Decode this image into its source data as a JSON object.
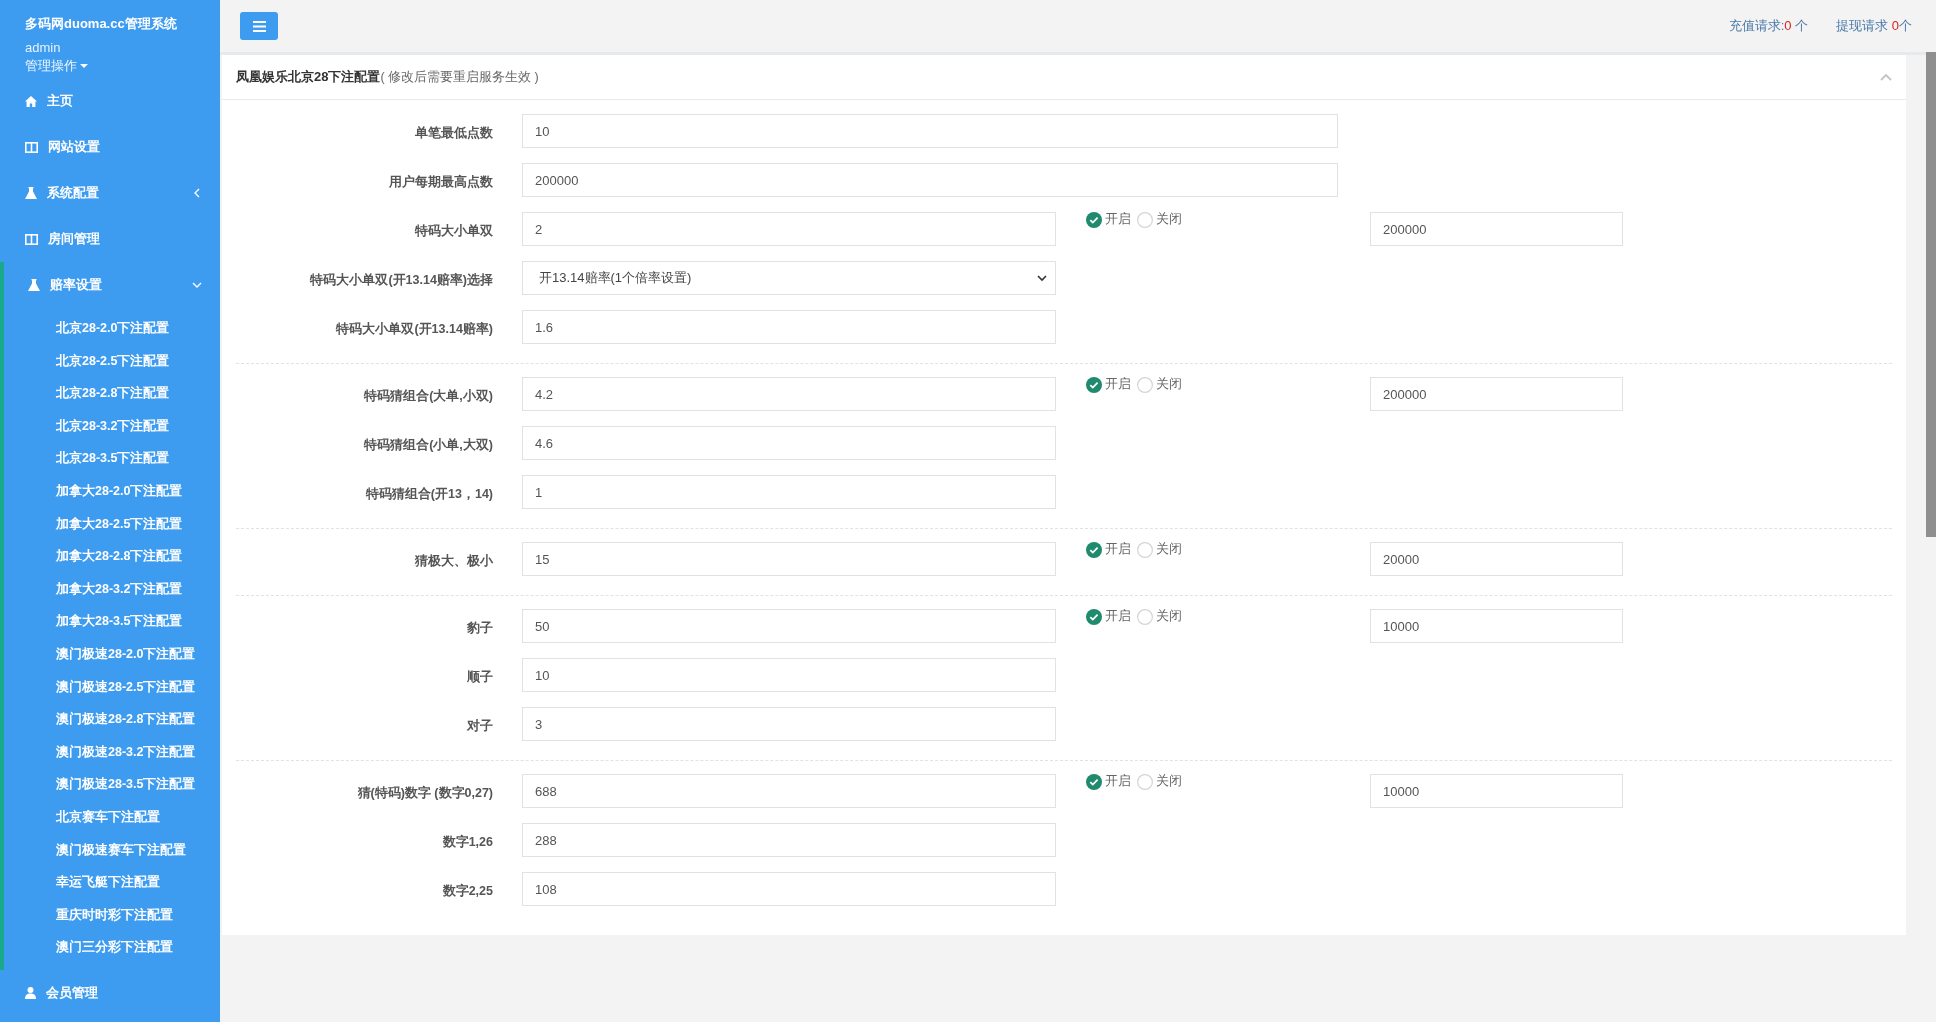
{
  "sidebar": {
    "brand": "多码网duoma.cc管理系统",
    "user": "admin",
    "user_menu": "管理操作",
    "items": [
      {
        "label": "主页",
        "kind": "home"
      },
      {
        "label": "网站设置",
        "kind": "page"
      },
      {
        "label": "系统配置",
        "kind": "group",
        "expanded": false
      },
      {
        "label": "房间管理",
        "kind": "page"
      },
      {
        "label": "赔率设置",
        "kind": "group",
        "expanded": true,
        "children": [
          {
            "label": "北京28-2.0下注配置"
          },
          {
            "label": "北京28-2.5下注配置"
          },
          {
            "label": "北京28-2.8下注配置"
          },
          {
            "label": "北京28-3.2下注配置"
          },
          {
            "label": "北京28-3.5下注配置"
          },
          {
            "label": "加拿大28-2.0下注配置"
          },
          {
            "label": "加拿大28-2.5下注配置"
          },
          {
            "label": "加拿大28-2.8下注配置"
          },
          {
            "label": "加拿大28-3.2下注配置"
          },
          {
            "label": "加拿大28-3.5下注配置"
          },
          {
            "label": "澳门极速28-2.0下注配置"
          },
          {
            "label": "澳门极速28-2.5下注配置"
          },
          {
            "label": "澳门极速28-2.8下注配置"
          },
          {
            "label": "澳门极速28-3.2下注配置"
          },
          {
            "label": "澳门极速28-3.5下注配置"
          },
          {
            "label": "北京赛车下注配置"
          },
          {
            "label": "澳门极速赛车下注配置"
          },
          {
            "label": "幸运飞艇下注配置"
          },
          {
            "label": "重庆时时彩下注配置"
          },
          {
            "label": "澳门三分彩下注配置"
          }
        ]
      },
      {
        "label": "会员管理",
        "kind": "members"
      }
    ]
  },
  "topbar": {
    "requests": [
      {
        "label": "充值请求:",
        "count": "0",
        "unit": " 个"
      },
      {
        "label": "提现请求 ",
        "count": "0",
        "unit": "个"
      }
    ]
  },
  "panel": {
    "title": "凤凰娱乐北京28下注配置",
    "note": "( 修改后需要重启服务生效 )",
    "sections": [
      {
        "rows": [
          {
            "kind": "wide",
            "label": "单笔最低点数",
            "value": "10"
          },
          {
            "kind": "wide",
            "label": "用户每期最高点数",
            "value": "200000"
          },
          {
            "kind": "input",
            "label": "特码大小单双",
            "value": "2",
            "toggle": {
              "on_label": "开启",
              "off_label": "关闭",
              "on": true
            },
            "limit": "200000"
          },
          {
            "kind": "select",
            "label": "特码大小单双(开13.14赔率)选择",
            "value": "开13.14赔率(1个倍率设置)"
          },
          {
            "kind": "input",
            "label": "特码大小单双(开13.14赔率)",
            "value": "1.6"
          }
        ]
      },
      {
        "rows": [
          {
            "kind": "input",
            "label": "特码猜组合(大单,小双)",
            "value": "4.2",
            "toggle": {
              "on_label": "开启",
              "off_label": "关闭",
              "on": true
            },
            "limit": "200000"
          },
          {
            "kind": "input",
            "label": "特码猜组合(小单,大双)",
            "value": "4.6"
          },
          {
            "kind": "input",
            "label": "特码猜组合(开13，14)",
            "value": "1"
          }
        ]
      },
      {
        "rows": [
          {
            "kind": "input",
            "label": "猜极大、极小",
            "value": "15",
            "toggle": {
              "on_label": "开启",
              "off_label": "关闭",
              "on": true
            },
            "limit": "20000"
          }
        ]
      },
      {
        "rows": [
          {
            "kind": "input",
            "label": "豹子",
            "value": "50",
            "toggle": {
              "on_label": "开启",
              "off_label": "关闭",
              "on": true
            },
            "limit": "10000"
          },
          {
            "kind": "input",
            "label": "顺子",
            "value": "10"
          },
          {
            "kind": "input",
            "label": "对子",
            "value": "3"
          }
        ]
      },
      {
        "rows": [
          {
            "kind": "input",
            "label": "猜(特码)数字 (数字0,27)",
            "value": "688",
            "toggle": {
              "on_label": "开启",
              "off_label": "关闭",
              "on": true
            },
            "limit": "10000"
          },
          {
            "kind": "input",
            "label": "数字1,26",
            "value": "288"
          },
          {
            "kind": "input",
            "label": "数字2,25",
            "value": "108"
          }
        ]
      }
    ]
  }
}
